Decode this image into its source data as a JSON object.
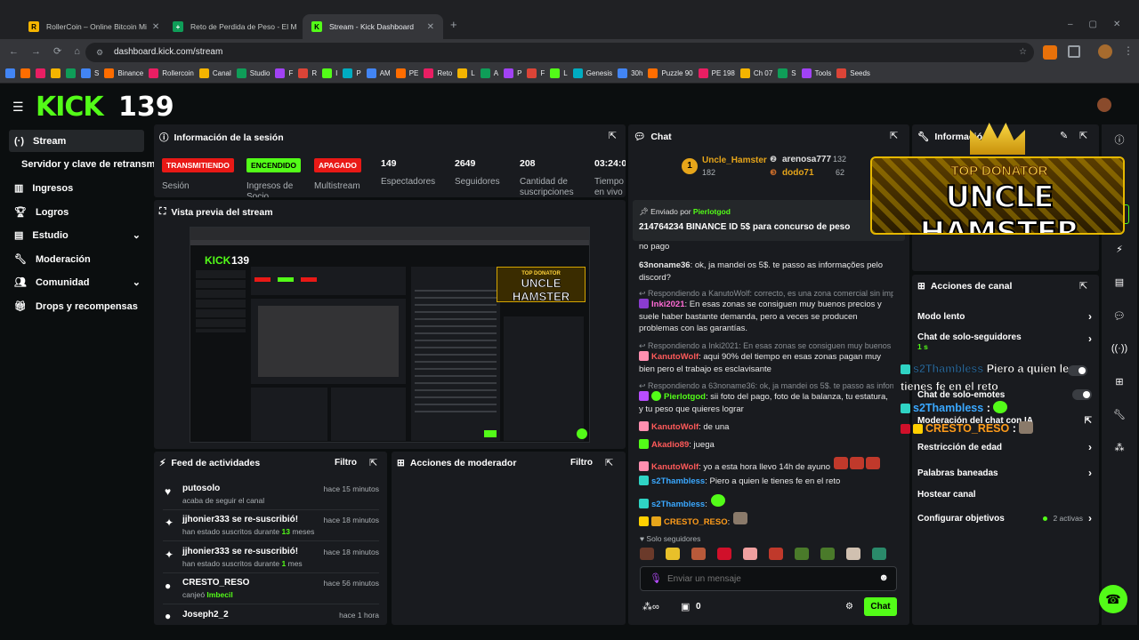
{
  "browser": {
    "tabs": [
      {
        "title": "RollerCoin – Online Bitcoin Mi"
      },
      {
        "title": "Reto de Perdida de Peso - El M"
      },
      {
        "title": "Stream - Kick Dashboard"
      }
    ],
    "url": "dashboard.kick.com/stream",
    "bookmarks": [
      "S",
      "Binance",
      "Rollercoin",
      "Canal",
      "Studio",
      "F",
      "R",
      "I",
      "P",
      "AM",
      "PE",
      "Reto",
      "L",
      "A",
      "P",
      "F",
      "L",
      "Genesis",
      "30h",
      "Puzzle 90",
      "PE 198",
      "Ch 07",
      "S",
      "Tools",
      "Seeds"
    ]
  },
  "header": {
    "logo": "KICK",
    "viewer_number": "139"
  },
  "sidebar": {
    "items": [
      {
        "label": "Stream"
      },
      {
        "label": "Servidor y clave de retransm"
      },
      {
        "label": "Ingresos"
      },
      {
        "label": "Logros"
      },
      {
        "label": "Estudio"
      },
      {
        "label": "Moderación"
      },
      {
        "label": "Comunidad"
      },
      {
        "label": "Drops y recompensas"
      }
    ]
  },
  "session": {
    "title": "Información de la sesión",
    "statuses": [
      {
        "pill": "TRANSMITIENDO",
        "label": "Sesión",
        "color": "#e91916"
      },
      {
        "pill": "ENCENDIDO",
        "label": "Ingresos de Socio",
        "color": "#53fc18"
      },
      {
        "pill": "APAGADO",
        "label": "Multistream",
        "color": "#e91916"
      }
    ],
    "stats": [
      {
        "value": "149",
        "label": "Espectadores"
      },
      {
        "value": "2649",
        "label": "Seguidores"
      },
      {
        "value": "208",
        "label": "Cantidad de suscripciones"
      },
      {
        "value": "03:24:0",
        "label": "Tiempo en vivo"
      }
    ]
  },
  "preview": {
    "title": "Vista previa del stream",
    "inner_number": "139",
    "inner_banner_top": "TOP DONATOR",
    "inner_banner_name": "UNCLE HAMSTER"
  },
  "feed": {
    "title": "Feed de actividades",
    "filter": "Filtro",
    "items": [
      {
        "name": "putosolo",
        "desc": "acaba de seguir el canal",
        "time": "hace 15 minutos"
      },
      {
        "name": "jjhonier333 se re-suscribió!",
        "desc_pre": "han estado suscritos durante ",
        "desc_num": "13",
        "desc_post": " meses",
        "time": "hace 18 minutos"
      },
      {
        "name": "jjhonier333 se re-suscribió!",
        "desc_pre": "han estado suscritos durante ",
        "desc_num": "1",
        "desc_post": " mes",
        "time": "hace 18 minutos"
      },
      {
        "name": "CRESTO_RESO",
        "desc_pre": "canjeó ",
        "desc_num": "Imbecil",
        "desc_post": "",
        "time": "hace 56 minutos"
      },
      {
        "name": "Joseph2_2",
        "time": "hace 1 hora"
      }
    ]
  },
  "modactions": {
    "title": "Acciones de moderador",
    "filter": "Filtro"
  },
  "chat": {
    "title": "Chat",
    "top_gifter": {
      "rank": "1",
      "name": "Uncle_Hamster",
      "amount": "182"
    },
    "top2": {
      "name": "arenosa777",
      "amount": "132"
    },
    "top3": {
      "name": "dodo71",
      "amount": "62"
    },
    "pinned": {
      "by_label": "Enviado por",
      "by_user": "Pierlotgod",
      "text": "214764234 BINANCE ID 5$ para concurso de peso"
    },
    "lines": [
      {
        "text": "no pago"
      },
      {
        "user": "63noname36",
        "text": ": ok, ja mandei os 5$. te passo as informações pelo discord?",
        "color": "#ffffff"
      },
      {
        "reply": "Respondiendo a KanutoWolf: correcto, es una zona comercial sin impu..."
      },
      {
        "user": "Inki2021",
        "text": ": En esas zonas se consiguen muy buenos precios y suele haber bastante demanda, pero a veces se producen problemas con las garantías.",
        "color": "#ffffff"
      },
      {
        "reply": "Respondiendo a Inki2021: En esas zonas se consiguen muy buenos pr..."
      },
      {
        "user": "KanutoWolf",
        "text": ": aqui 90% del tiempo en esas zonas pagan muy bien pero el trabajo es esclavisante",
        "color": "#ff5a5a"
      },
      {
        "reply": "Respondiendo a 63noname36: ok, ja mandei os 5$. te passo as inform..."
      },
      {
        "user": "Pierlotgod",
        "text": ": sii foto del pago, foto de la balanza, tu estatura, y tu peso que quieres lograr",
        "color": "#ffffff"
      },
      {
        "user": "KanutoWolf",
        "text": ": de una",
        "color": "#ff5a5a"
      },
      {
        "user": "Akadio89",
        "text": ": juega",
        "color": "#ff5a5a"
      },
      {
        "user": "KanutoWolf",
        "text": ": yo a esta hora llevo 14h de ayuno",
        "color": "#ff5a5a"
      },
      {
        "user": "s2Thambless",
        "text": ": Piero a quien le tienes fe en el reto",
        "color": "#3aa8ff"
      },
      {
        "user": "s2Thambless",
        "text": ":",
        "color": "#3aa8ff"
      },
      {
        "user": "CRESTO_RESO",
        "text": ":",
        "color": "#ff9c1a"
      }
    ],
    "followers_only": "Solo seguidores",
    "placeholder": "Enviar un mensaje",
    "count": "0",
    "send": "Chat"
  },
  "info": {
    "title": "Informació"
  },
  "banner": {
    "top": "TOP DONATOR",
    "name": "UNCLE HAMSTER"
  },
  "overlay": {
    "line1": "Piero a quien le",
    "line2": "tienes fe en el reto",
    "user2": "s2Thambless",
    "user3": "CRESTO_RESO"
  },
  "channel_actions": {
    "title": "Acciones de canal",
    "items": [
      {
        "label": "Modo lento"
      },
      {
        "label": "Chat de solo-seguidores",
        "sub": "1 s"
      },
      {
        "label": "Chat de solo-emotes"
      },
      {
        "label": "Moderación del chat con IA"
      },
      {
        "label": "Restricción de edad"
      },
      {
        "label": "Palabras baneadas"
      },
      {
        "label": "Hostear canal"
      },
      {
        "label": "Configurar objetivos",
        "sub": "2 activas"
      }
    ]
  }
}
